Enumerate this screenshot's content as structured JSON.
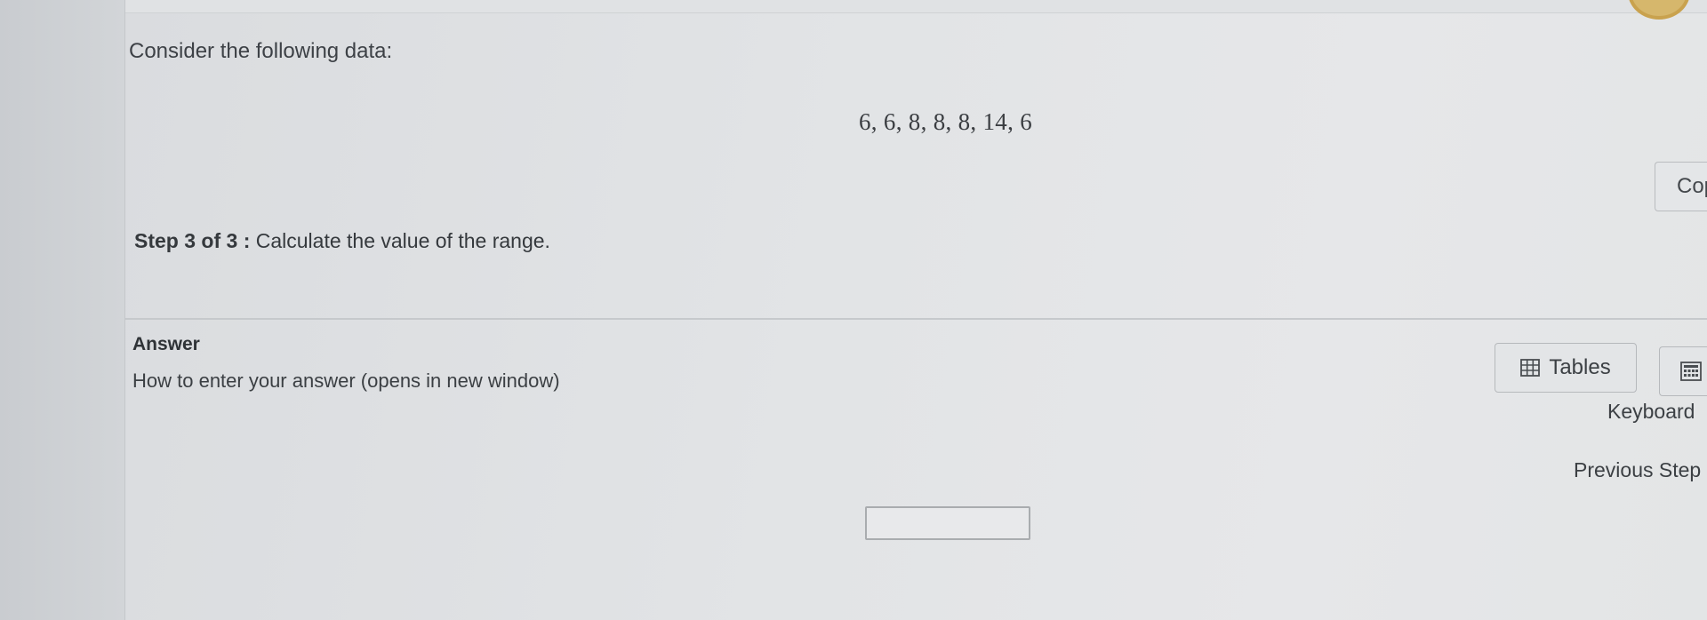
{
  "question": {
    "prompt": "Consider the following data:",
    "dataset": "6, 6, 8, 8, 8, 14, 6",
    "step_label": "Step 3 of 3 :",
    "step_text": "Calculate the value of the range."
  },
  "toolbar": {
    "copy_label": "Cop",
    "tables_label": "Tables",
    "tables_icon": "table-icon",
    "keyboard_label": "Keyboard",
    "keyboard_icon": "keyboard-icon",
    "previous_step_label": "Previous Step"
  },
  "answer": {
    "heading": "Answer",
    "howto_link": "How to enter your answer (opens in new window)",
    "value": ""
  },
  "colors": {
    "accent_orb": "#d6b76c"
  }
}
